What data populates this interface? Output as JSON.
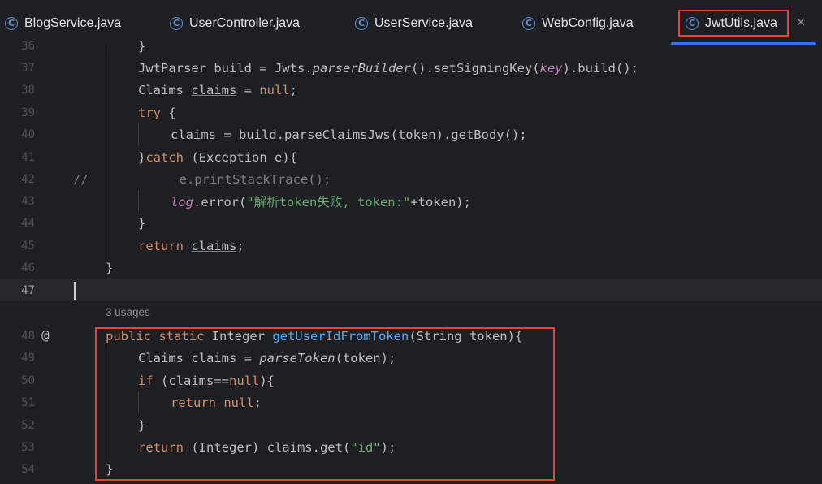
{
  "tabs": [
    {
      "label": "BlogService.java"
    },
    {
      "label": "UserController.java"
    },
    {
      "label": "UserService.java"
    },
    {
      "label": "WebConfig.java"
    },
    {
      "label": "JwtUtils.java",
      "active": true
    }
  ],
  "tab_icon_glyph": "C",
  "close_glyph": "×",
  "usages_hint": "3 usages",
  "at_glyph": "@",
  "lines": [
    {
      "num": "36",
      "text": "}"
    },
    {
      "num": "37",
      "text": "JwtParser build = Jwts.parserBuilder().setSigningKey(key).build();"
    },
    {
      "num": "38",
      "text": "Claims claims = null;"
    },
    {
      "num": "39",
      "text": "try {"
    },
    {
      "num": "40",
      "text": "claims = build.parseClaimsJws(token).getBody();"
    },
    {
      "num": "41",
      "text": "}catch (Exception e){"
    },
    {
      "num": "42",
      "text": "//            e.printStackTrace();"
    },
    {
      "num": "43",
      "text": "log.error(\"解析token失败, token:\"+token);"
    },
    {
      "num": "44",
      "text": "}"
    },
    {
      "num": "45",
      "text": "return claims;"
    },
    {
      "num": "46",
      "text": "}"
    },
    {
      "num": "47",
      "text": ""
    },
    {
      "num": "48",
      "text": "public static Integer getUserIdFromToken(String token){"
    },
    {
      "num": "49",
      "text": "Claims claims = parseToken(token);"
    },
    {
      "num": "50",
      "text": "if (claims==null){"
    },
    {
      "num": "51",
      "text": "return null;"
    },
    {
      "num": "52",
      "text": "}"
    },
    {
      "num": "53",
      "text": "return (Integer) claims.get(\"id\");"
    },
    {
      "num": "54",
      "text": "}"
    }
  ],
  "colors": {
    "background": "#1e1f22",
    "keyword": "#cf8e6d",
    "function": "#56a8f5",
    "string": "#6aab73",
    "field": "#c77dbb",
    "highlight_box": "#e8403a",
    "active_tab_underline": "#3574f0"
  }
}
